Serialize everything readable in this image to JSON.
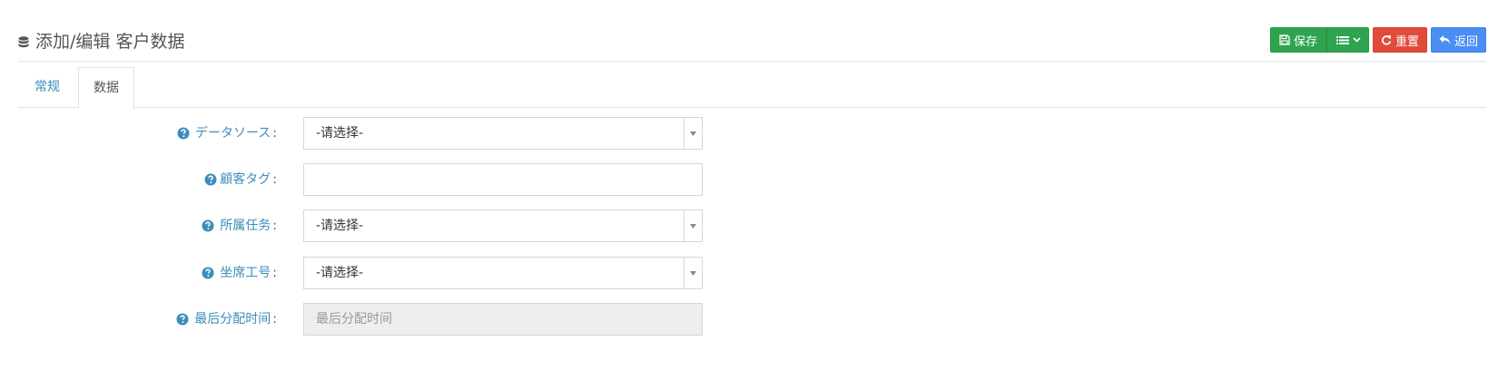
{
  "header": {
    "title": "添加/编辑 客户数据",
    "icon": "database-icon"
  },
  "toolbar": {
    "save_label": "保存",
    "reset_label": "重置",
    "back_label": "返回",
    "colors": {
      "save": "#2ea44f",
      "reset": "#e04b3a",
      "back": "#4a8ef5"
    }
  },
  "tabs": [
    {
      "label": "常规",
      "active": false
    },
    {
      "label": "数据",
      "active": true
    }
  ],
  "form": {
    "fields": [
      {
        "label": "データソース",
        "type": "select",
        "value": "-请选择-"
      },
      {
        "label": "顧客タグ",
        "type": "text",
        "value": ""
      },
      {
        "label": "所属任务",
        "type": "select",
        "value": "-请选择-"
      },
      {
        "label": "坐席工号",
        "type": "select",
        "value": "-请选择-"
      },
      {
        "label": "最后分配时间",
        "type": "text-disabled",
        "value": "",
        "placeholder": "最后分配时间"
      }
    ],
    "colon": ":"
  },
  "colors": {
    "link": "#3c8dbc"
  }
}
